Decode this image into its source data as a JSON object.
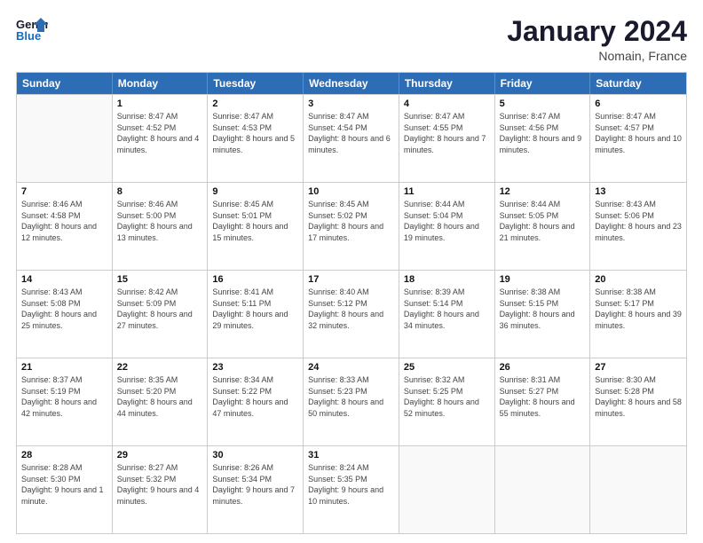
{
  "header": {
    "logo_line1": "General",
    "logo_line2": "Blue",
    "month": "January 2024",
    "location": "Nomain, France"
  },
  "days": [
    "Sunday",
    "Monday",
    "Tuesday",
    "Wednesday",
    "Thursday",
    "Friday",
    "Saturday"
  ],
  "weeks": [
    [
      {
        "day": null,
        "sunrise": null,
        "sunset": null,
        "daylight": null
      },
      {
        "day": "1",
        "sunrise": "8:47 AM",
        "sunset": "4:52 PM",
        "daylight": "8 hours and 4 minutes."
      },
      {
        "day": "2",
        "sunrise": "8:47 AM",
        "sunset": "4:53 PM",
        "daylight": "8 hours and 5 minutes."
      },
      {
        "day": "3",
        "sunrise": "8:47 AM",
        "sunset": "4:54 PM",
        "daylight": "8 hours and 6 minutes."
      },
      {
        "day": "4",
        "sunrise": "8:47 AM",
        "sunset": "4:55 PM",
        "daylight": "8 hours and 7 minutes."
      },
      {
        "day": "5",
        "sunrise": "8:47 AM",
        "sunset": "4:56 PM",
        "daylight": "8 hours and 9 minutes."
      },
      {
        "day": "6",
        "sunrise": "8:47 AM",
        "sunset": "4:57 PM",
        "daylight": "8 hours and 10 minutes."
      }
    ],
    [
      {
        "day": "7",
        "sunrise": "8:46 AM",
        "sunset": "4:58 PM",
        "daylight": "8 hours and 12 minutes."
      },
      {
        "day": "8",
        "sunrise": "8:46 AM",
        "sunset": "5:00 PM",
        "daylight": "8 hours and 13 minutes."
      },
      {
        "day": "9",
        "sunrise": "8:45 AM",
        "sunset": "5:01 PM",
        "daylight": "8 hours and 15 minutes."
      },
      {
        "day": "10",
        "sunrise": "8:45 AM",
        "sunset": "5:02 PM",
        "daylight": "8 hours and 17 minutes."
      },
      {
        "day": "11",
        "sunrise": "8:44 AM",
        "sunset": "5:04 PM",
        "daylight": "8 hours and 19 minutes."
      },
      {
        "day": "12",
        "sunrise": "8:44 AM",
        "sunset": "5:05 PM",
        "daylight": "8 hours and 21 minutes."
      },
      {
        "day": "13",
        "sunrise": "8:43 AM",
        "sunset": "5:06 PM",
        "daylight": "8 hours and 23 minutes."
      }
    ],
    [
      {
        "day": "14",
        "sunrise": "8:43 AM",
        "sunset": "5:08 PM",
        "daylight": "8 hours and 25 minutes."
      },
      {
        "day": "15",
        "sunrise": "8:42 AM",
        "sunset": "5:09 PM",
        "daylight": "8 hours and 27 minutes."
      },
      {
        "day": "16",
        "sunrise": "8:41 AM",
        "sunset": "5:11 PM",
        "daylight": "8 hours and 29 minutes."
      },
      {
        "day": "17",
        "sunrise": "8:40 AM",
        "sunset": "5:12 PM",
        "daylight": "8 hours and 32 minutes."
      },
      {
        "day": "18",
        "sunrise": "8:39 AM",
        "sunset": "5:14 PM",
        "daylight": "8 hours and 34 minutes."
      },
      {
        "day": "19",
        "sunrise": "8:38 AM",
        "sunset": "5:15 PM",
        "daylight": "8 hours and 36 minutes."
      },
      {
        "day": "20",
        "sunrise": "8:38 AM",
        "sunset": "5:17 PM",
        "daylight": "8 hours and 39 minutes."
      }
    ],
    [
      {
        "day": "21",
        "sunrise": "8:37 AM",
        "sunset": "5:19 PM",
        "daylight": "8 hours and 42 minutes."
      },
      {
        "day": "22",
        "sunrise": "8:35 AM",
        "sunset": "5:20 PM",
        "daylight": "8 hours and 44 minutes."
      },
      {
        "day": "23",
        "sunrise": "8:34 AM",
        "sunset": "5:22 PM",
        "daylight": "8 hours and 47 minutes."
      },
      {
        "day": "24",
        "sunrise": "8:33 AM",
        "sunset": "5:23 PM",
        "daylight": "8 hours and 50 minutes."
      },
      {
        "day": "25",
        "sunrise": "8:32 AM",
        "sunset": "5:25 PM",
        "daylight": "8 hours and 52 minutes."
      },
      {
        "day": "26",
        "sunrise": "8:31 AM",
        "sunset": "5:27 PM",
        "daylight": "8 hours and 55 minutes."
      },
      {
        "day": "27",
        "sunrise": "8:30 AM",
        "sunset": "5:28 PM",
        "daylight": "8 hours and 58 minutes."
      }
    ],
    [
      {
        "day": "28",
        "sunrise": "8:28 AM",
        "sunset": "5:30 PM",
        "daylight": "9 hours and 1 minute."
      },
      {
        "day": "29",
        "sunrise": "8:27 AM",
        "sunset": "5:32 PM",
        "daylight": "9 hours and 4 minutes."
      },
      {
        "day": "30",
        "sunrise": "8:26 AM",
        "sunset": "5:34 PM",
        "daylight": "9 hours and 7 minutes."
      },
      {
        "day": "31",
        "sunrise": "8:24 AM",
        "sunset": "5:35 PM",
        "daylight": "9 hours and 10 minutes."
      },
      {
        "day": null,
        "sunrise": null,
        "sunset": null,
        "daylight": null
      },
      {
        "day": null,
        "sunrise": null,
        "sunset": null,
        "daylight": null
      },
      {
        "day": null,
        "sunrise": null,
        "sunset": null,
        "daylight": null
      }
    ]
  ]
}
